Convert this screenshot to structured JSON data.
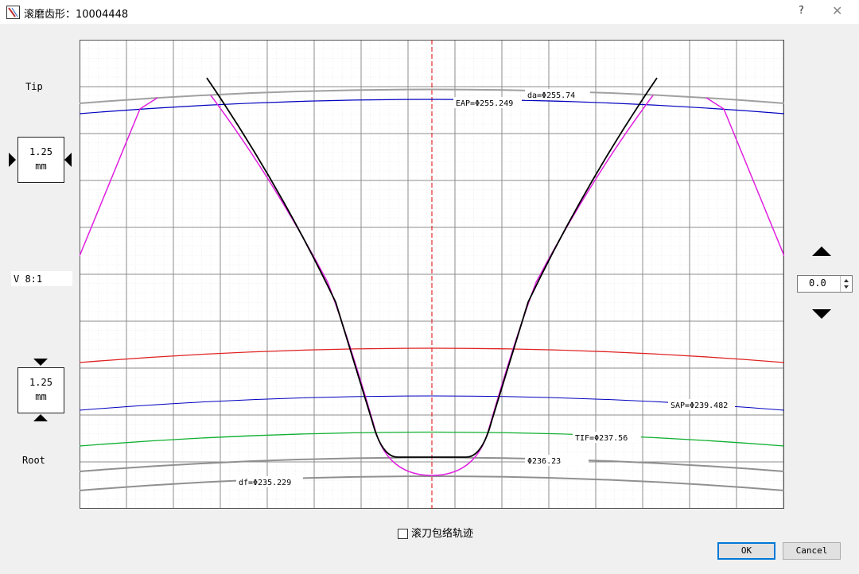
{
  "window": {
    "title": "滚磨齿形：10004448",
    "help": "?",
    "close": "✕"
  },
  "left_panel": {
    "tip_label": "Tip",
    "root_label": "Root",
    "upper_box": {
      "value": "1.25",
      "unit": "mm"
    },
    "lower_box": {
      "value": "1.25",
      "unit": "mm"
    },
    "ratio_label": "V 8:1"
  },
  "right_panel": {
    "offset_value": "0.0"
  },
  "plot": {
    "labels": {
      "da": "da=Φ255.74",
      "eap": "EAP=Φ255.249",
      "sap": "SAP=Φ239.482",
      "tif": "TIF=Φ237.56",
      "mid": "Φ236.23",
      "df": "df=Φ235.229"
    },
    "colors": {
      "background": "#ffffff",
      "grid_major": "#8c8c8c",
      "grid_minor": "#c8c8c8",
      "centerline": "#e00000",
      "da_circle": "#a0a0a0",
      "eap_circle": "#0000c0",
      "red_circle": "#e02020",
      "sap_circle": "#0000c0",
      "tif_circle": "#10b030",
      "mid_circle": "#909090",
      "df_circle": "#909090",
      "hob_profile": "#e020e0",
      "tooth_profile": "#000000"
    }
  },
  "footer": {
    "checkbox_label": "滚刀包络轨迹",
    "checkbox_checked": false,
    "ok_label": "OK",
    "cancel_label": "Cancel"
  }
}
